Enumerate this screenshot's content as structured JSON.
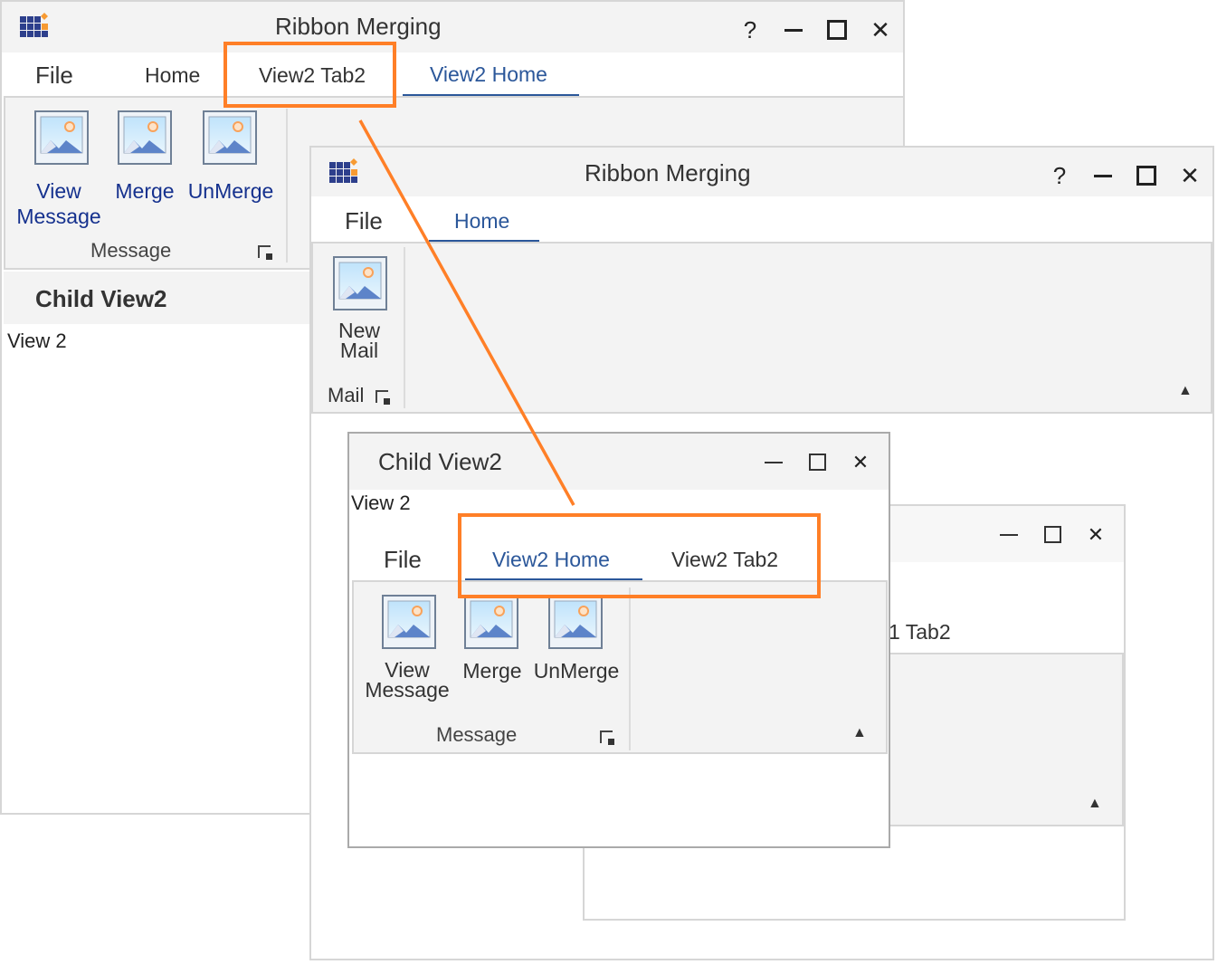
{
  "colors": {
    "accent": "#2b579a",
    "highlight": "#ff7f27",
    "button_text": "#15318e"
  },
  "parent_window": {
    "title": "Ribbon Merging",
    "controls": {
      "help": "?",
      "minimize": "—",
      "maximize": "☐",
      "close": "✕"
    },
    "tabs": [
      {
        "label": "File"
      },
      {
        "label": "Home"
      },
      {
        "label": "View2 Tab2"
      },
      {
        "label": "View2 Home",
        "active": true
      }
    ],
    "group": {
      "label": "Message",
      "buttons": [
        {
          "label": "View Message",
          "line1": "View",
          "line2": "Message"
        },
        {
          "label": "Merge"
        },
        {
          "label": "UnMerge"
        }
      ]
    },
    "child_header": "Child View2",
    "child_content": "View 2"
  },
  "merged_window": {
    "title": "Ribbon Merging",
    "controls": {
      "help": "?",
      "minimize": "—",
      "maximize": "☐",
      "close": "✕"
    },
    "tabs": [
      {
        "label": "File"
      },
      {
        "label": "Home",
        "active": true
      }
    ],
    "group": {
      "label": "Mail",
      "buttons": [
        {
          "label": "New Mail",
          "line1": "New",
          "line2": "Mail"
        }
      ]
    }
  },
  "child_window": {
    "title": "Child View2",
    "controls": {
      "minimize": "—",
      "maximize": "☐",
      "close": "✕"
    },
    "content": "View 2",
    "tabs": [
      {
        "label": "File"
      },
      {
        "label": "View2 Home",
        "active": true
      },
      {
        "label": "View2 Tab2"
      }
    ],
    "group": {
      "label": "Message",
      "buttons": [
        {
          "label": "View Message",
          "line1": "View",
          "line2": "Message"
        },
        {
          "label": "Merge"
        },
        {
          "label": "UnMerge"
        }
      ]
    }
  },
  "background_child_window": {
    "controls": {
      "minimize": "—",
      "maximize": "☐",
      "close": "✕"
    },
    "tab_partial": "1 Tab2"
  },
  "icons": {
    "app": "app-grid-icon",
    "button": "image-placeholder-icon",
    "launcher": "dialog-launcher-icon",
    "collapse": "chevron-up-icon"
  }
}
